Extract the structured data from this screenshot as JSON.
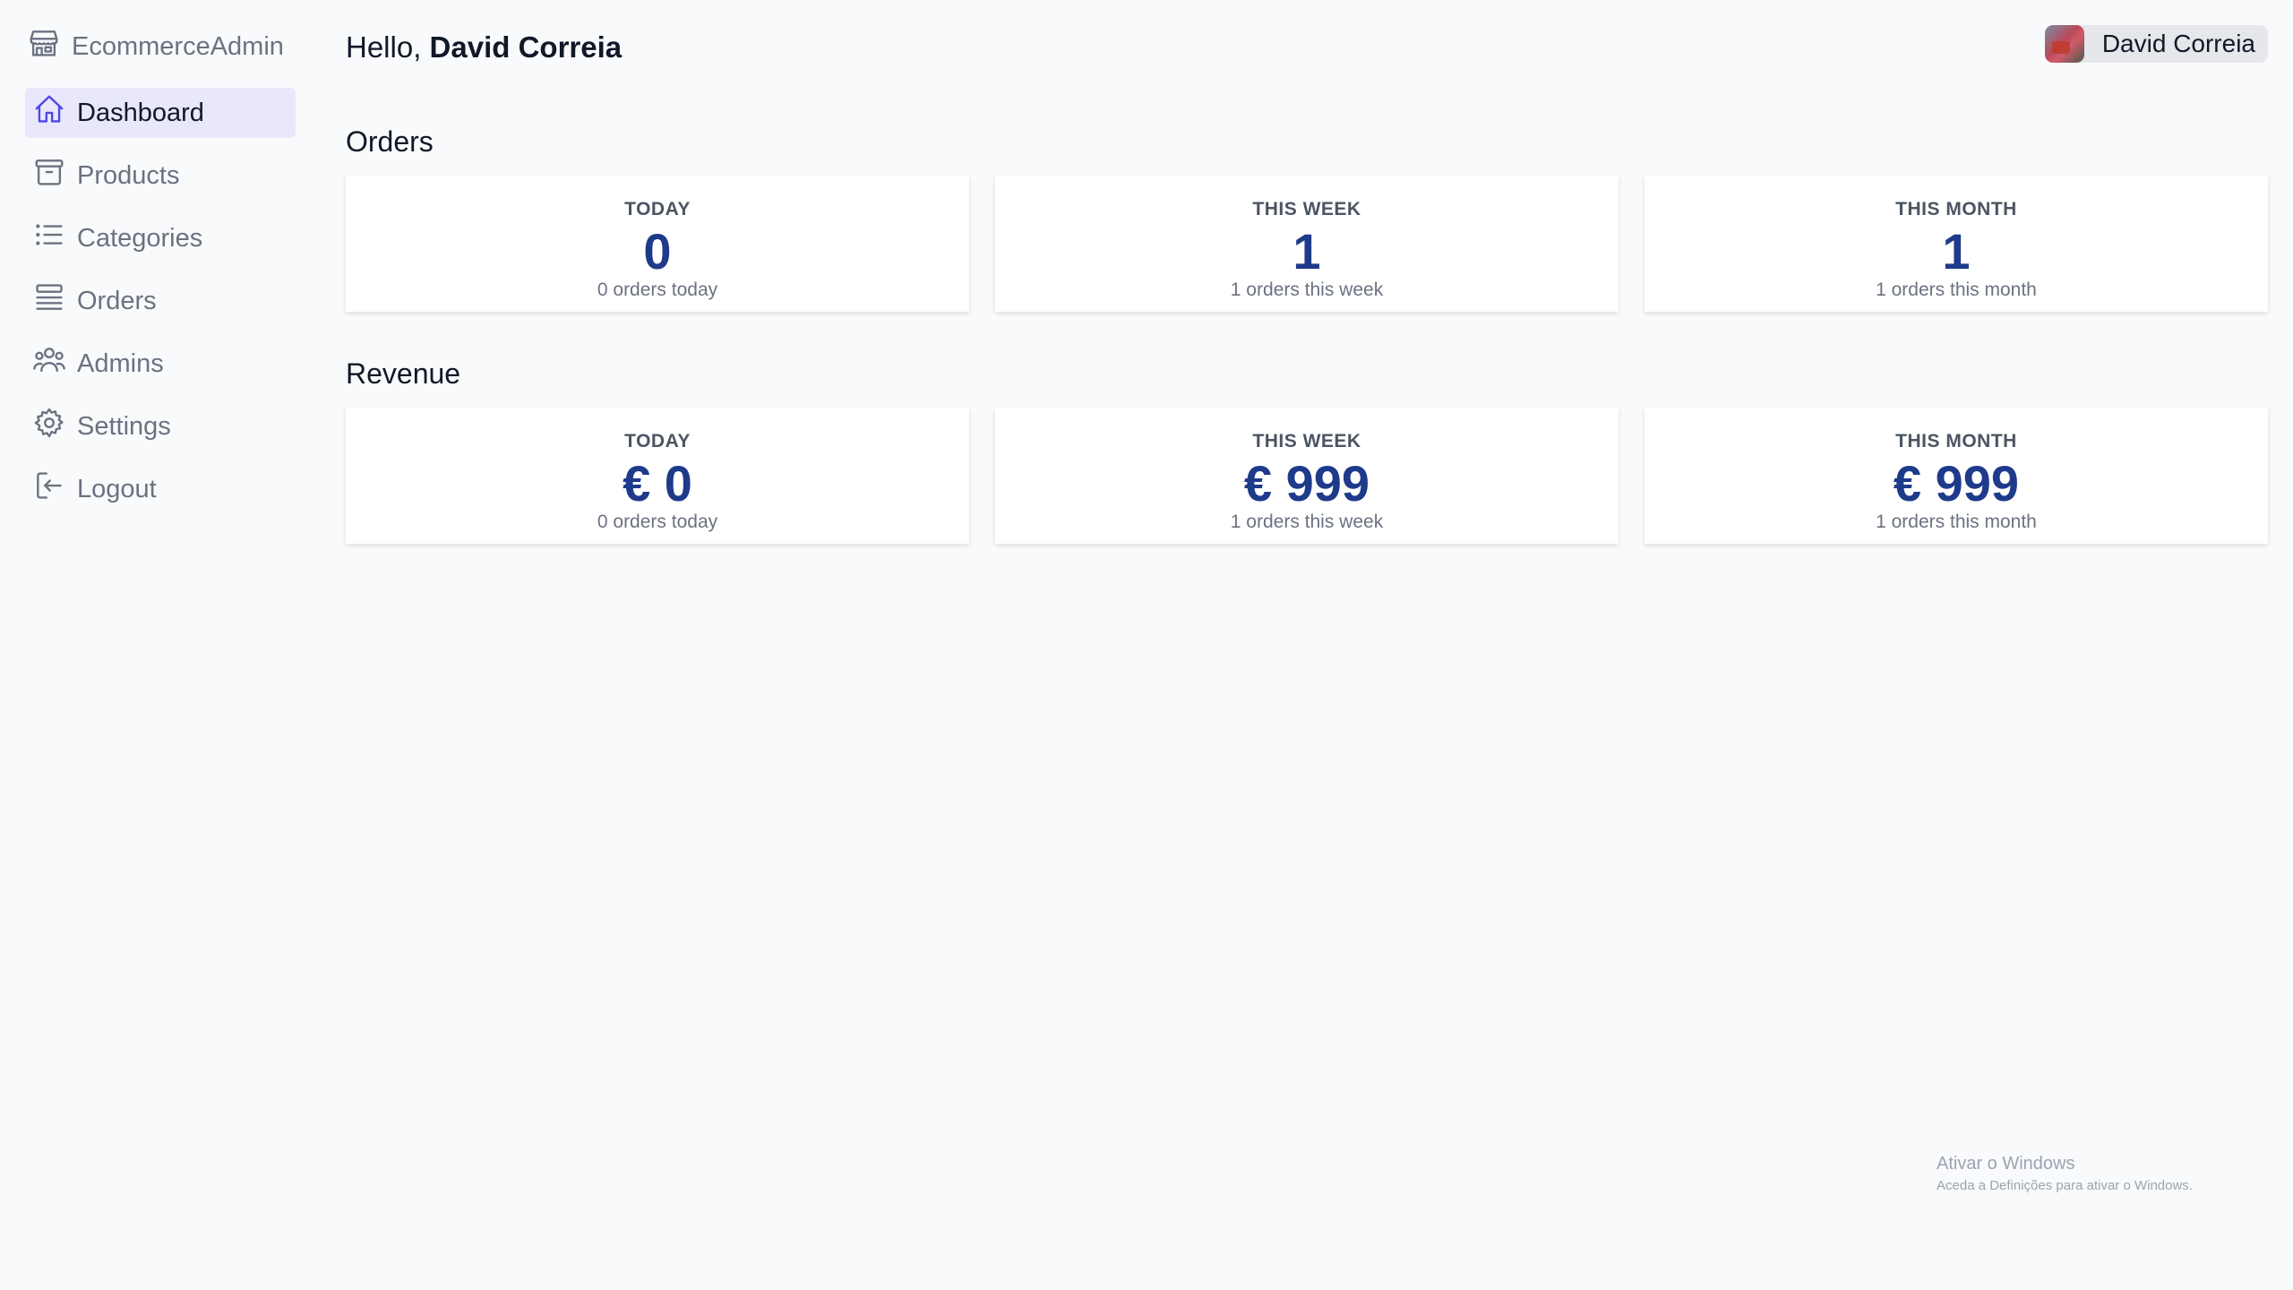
{
  "brand": {
    "name": "EcommerceAdmin",
    "icon": "store-icon"
  },
  "nav": {
    "items": [
      {
        "label": "Dashboard",
        "icon": "home-icon",
        "active": true
      },
      {
        "label": "Products",
        "icon": "archive-box-icon",
        "active": false
      },
      {
        "label": "Categories",
        "icon": "list-icon",
        "active": false
      },
      {
        "label": "Orders",
        "icon": "queue-list-icon",
        "active": false
      },
      {
        "label": "Admins",
        "icon": "users-icon",
        "active": false
      },
      {
        "label": "Settings",
        "icon": "gear-icon",
        "active": false
      },
      {
        "label": "Logout",
        "icon": "logout-icon",
        "active": false
      }
    ]
  },
  "header": {
    "greeting_prefix": "Hello,",
    "user_name": "David Correia"
  },
  "user_chip": {
    "name": "David Correia"
  },
  "orders": {
    "title": "Orders",
    "cards": [
      {
        "label": "TODAY",
        "value": "0",
        "sub": "0 orders today"
      },
      {
        "label": "THIS WEEK",
        "value": "1",
        "sub": "1 orders this week"
      },
      {
        "label": "THIS MONTH",
        "value": "1",
        "sub": "1 orders this month"
      }
    ]
  },
  "revenue": {
    "title": "Revenue",
    "cards": [
      {
        "label": "TODAY",
        "value": "€ 0",
        "sub": "0 orders today"
      },
      {
        "label": "THIS WEEK",
        "value": "€ 999",
        "sub": "1 orders this week"
      },
      {
        "label": "THIS MONTH",
        "value": "€ 999",
        "sub": "1 orders this month"
      }
    ]
  },
  "watermark": {
    "line1": "Ativar o Windows",
    "line2": "Aceda a Definições para ativar o Windows."
  },
  "colors": {
    "accent": "#4f46e5",
    "active_bg": "#e8e7fb",
    "value_color": "#1e3a8a",
    "background": "#f9fafc"
  }
}
